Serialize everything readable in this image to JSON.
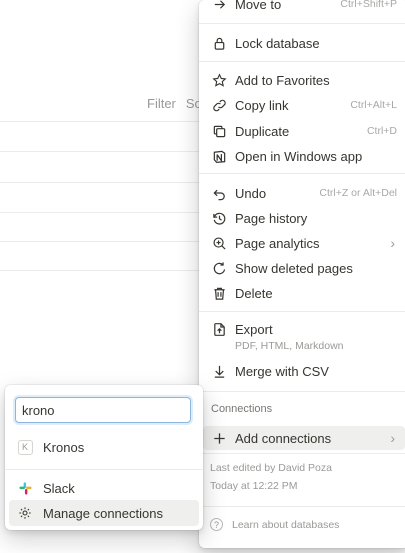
{
  "toolbar": {
    "filter": "Filter",
    "sort_partial": "So"
  },
  "menu": {
    "top_cut_label": "Move to",
    "top_cut_shortcut": "Ctrl+Shift+P",
    "lock": "Lock database",
    "favorites": "Add to Favorites",
    "copy_link": "Copy link",
    "copy_link_sc": "Ctrl+Alt+L",
    "duplicate": "Duplicate",
    "duplicate_sc": "Ctrl+D",
    "open_windows": "Open in Windows app",
    "undo": "Undo",
    "undo_sc": "Ctrl+Z or Alt+Del",
    "page_history": "Page history",
    "page_analytics": "Page analytics",
    "show_deleted": "Show deleted pages",
    "delete": "Delete",
    "export": "Export",
    "export_sub": "PDF, HTML, Markdown",
    "merge_csv": "Merge with CSV",
    "connections_label": "Connections",
    "add_connections": "Add connections",
    "last_edited": "Last edited by David Poza",
    "edited_time": "Today at 12:22 PM",
    "learn": "Learn about databases"
  },
  "popup": {
    "search_value": "krono",
    "result": "Kronos",
    "result_badge": "K",
    "slack": "Slack",
    "manage": "Manage connections"
  }
}
